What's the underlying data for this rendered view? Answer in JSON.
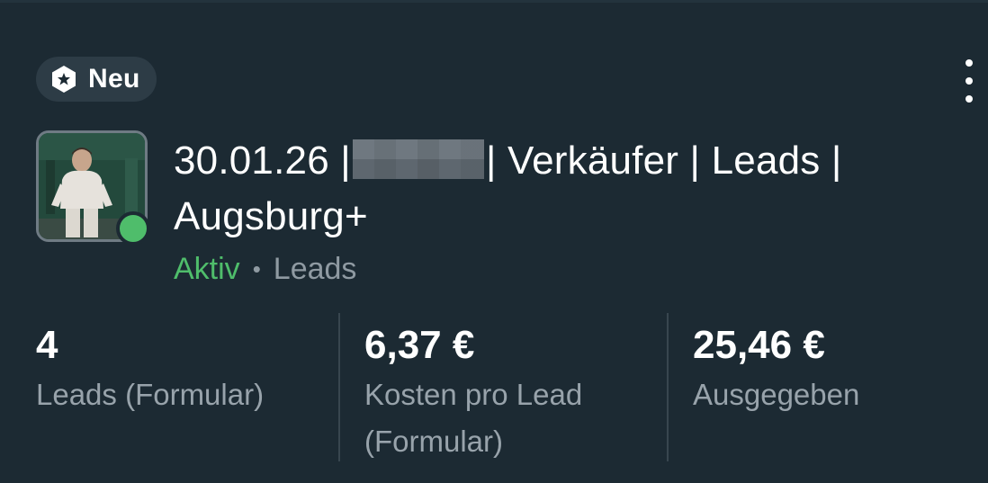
{
  "badge": {
    "label": "Neu",
    "icon": "star-hexagon-icon"
  },
  "menu": {
    "icon": "more-vertical-icon"
  },
  "campaign": {
    "thumbnail": "person-thumbnail",
    "status_dot_color": "#4fbd6b",
    "title_part1": "30.01.26 |",
    "title_part2": "| Verkäufer | Leads | Augsburg+",
    "status": "Aktiv",
    "separator": "•",
    "type": "Leads"
  },
  "stats": [
    {
      "value": "4",
      "label": "Leads (Formular)"
    },
    {
      "value": "6,37 €",
      "label": "Kosten pro Lead (Formular)"
    },
    {
      "value": "25,46 €",
      "label": "Ausgegeben"
    }
  ],
  "colors": {
    "background": "#1c2a33",
    "active_green": "#4fbd6b",
    "muted_text": "#98a3ab"
  }
}
